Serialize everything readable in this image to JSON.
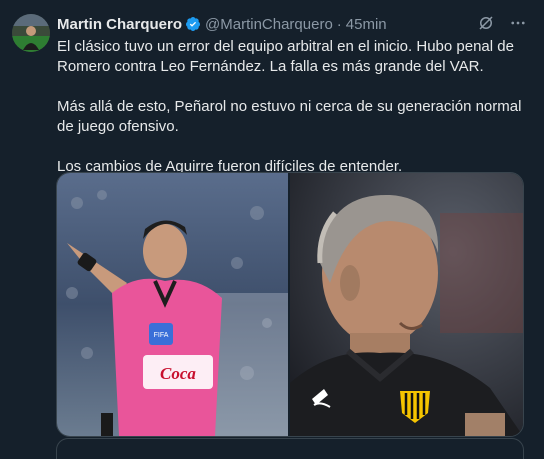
{
  "tweet": {
    "author_name": "Martin Charquero",
    "handle": "@MartinCharquero",
    "separator": "·",
    "time": "45min",
    "paragraphs": [
      "El clásico tuvo un error del equipo arbitral en el inicio. Hubo penal de Romero contra Leo Fernández. La falla es más grande del VAR.",
      "Más allá de esto, Peñarol no estuvo ni cerca de su generación normal de juego ofensivo.",
      "Los cambios de Aguirre fueron difíciles de entender."
    ]
  },
  "icons": {
    "verified": "verified-badge-icon",
    "grok": "grok-icon",
    "more": "more-options-icon"
  },
  "colors": {
    "background": "#15202b",
    "verified_blue": "#1d9bf0",
    "secondary_text": "#8b98a5",
    "referee_shirt": "#e9559a"
  },
  "media": {
    "left_image_text": "Coca"
  }
}
